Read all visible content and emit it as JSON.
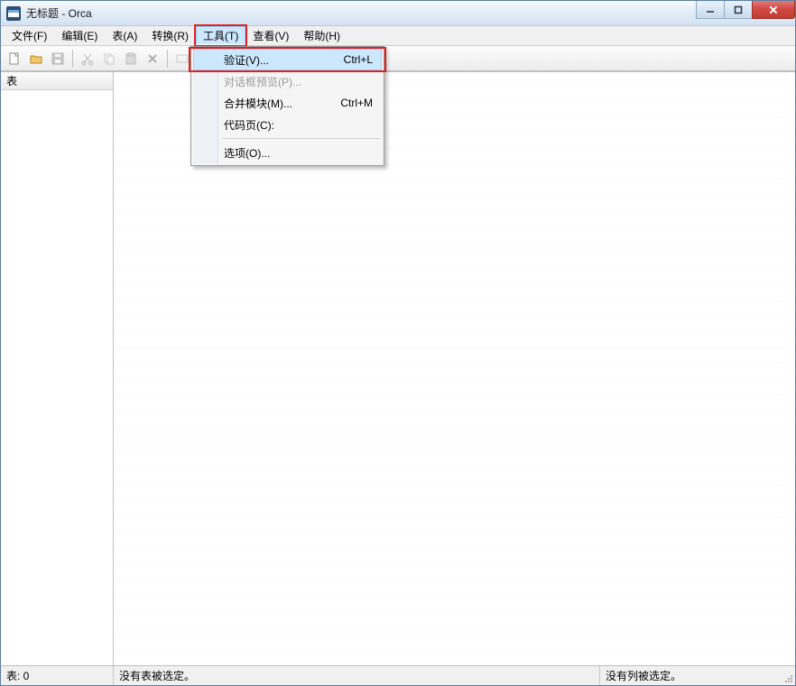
{
  "window": {
    "title": "无标题 - Orca"
  },
  "menubar": {
    "items": [
      {
        "label": "文件(F)"
      },
      {
        "label": "编辑(E)"
      },
      {
        "label": "表(A)"
      },
      {
        "label": "转换(R)"
      },
      {
        "label": "工具(T)",
        "open": true,
        "highlight": true
      },
      {
        "label": "查看(V)"
      },
      {
        "label": "帮助(H)"
      }
    ]
  },
  "dropdown": {
    "items": [
      {
        "label": "验证(V)...",
        "shortcut": "Ctrl+L",
        "selected": true,
        "highlight": true
      },
      {
        "label": "对话框预览(P)...",
        "disabled": true
      },
      {
        "label": "合并模块(M)...",
        "shortcut": "Ctrl+M"
      },
      {
        "label": "代码页(C):"
      },
      {
        "type": "separator"
      },
      {
        "label": "选项(O)..."
      }
    ]
  },
  "left_pane": {
    "header": "表"
  },
  "statusbar": {
    "cell1": "表: 0",
    "cell2": "没有表被选定。",
    "cell3": "没有列被选定。"
  },
  "toolbar_icons": {
    "new": "new-file-icon",
    "open": "open-folder-icon",
    "save": "save-icon",
    "cut": "cut-icon",
    "copy": "copy-icon",
    "paste": "paste-icon",
    "delete": "delete-icon",
    "tool1": "tool-icon",
    "tool2": "tool-icon"
  }
}
